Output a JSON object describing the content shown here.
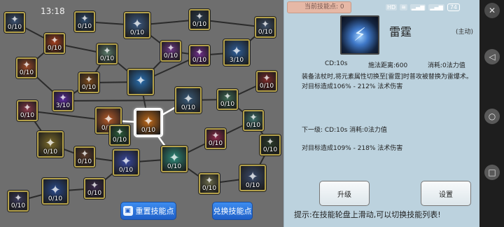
{
  "status_bar": {
    "time": "13:18",
    "signals": [
      "HD",
      "wifi",
      "HD"
    ],
    "battery": "74"
  },
  "tree": {
    "buttons": [
      {
        "label": "重置技能点"
      },
      {
        "label": "兑换技能点"
      }
    ],
    "nodes": [
      {
        "level": "0/10",
        "color": "#3a4f6e",
        "icon": "chain-icon"
      },
      {
        "level": "0/10",
        "color": "#2f4a6a",
        "icon": "wisp-icon"
      },
      {
        "level": "0/10",
        "color": "#3c5a82",
        "icon": "spiral-icon"
      },
      {
        "level": "0/10",
        "color": "#2a3a4a",
        "icon": "beetle-icon"
      },
      {
        "level": "0/10",
        "color": "#a33e1e",
        "icon": "fire-icon"
      },
      {
        "level": "0/10",
        "color": "#3d4f66",
        "icon": "shell-icon"
      },
      {
        "level": "0/10",
        "color": "#5b7a6a",
        "icon": "wave-icon"
      },
      {
        "level": "0/10",
        "color": "#6f3a86",
        "icon": "rune-icon"
      },
      {
        "level": "3/10",
        "color": "#2f5f9a",
        "icon": "thunder-icon"
      },
      {
        "level": "0/10",
        "color": "#9a4a2a",
        "icon": "eye-icon"
      },
      {
        "level": "0/10",
        "color": "#7a4a1e",
        "icon": "sword-icon"
      },
      {
        "level": "",
        "color": "#2a6fb0",
        "icon": "ice-knight-icon"
      },
      {
        "level": "0/10",
        "color": "#6f2f8a",
        "icon": "storm-icon"
      },
      {
        "level": "0/10",
        "color": "#b35a2a",
        "icon": "meteor-icon"
      },
      {
        "level": "0/10",
        "color": "#7a2a2a",
        "icon": "blood-icon"
      },
      {
        "level": "3/10",
        "color": "#5a2a9a",
        "icon": "lightning-icon"
      },
      {
        "level": "0/10",
        "color": "#3f6a55",
        "icon": "rock-icon"
      },
      {
        "level": "0/10",
        "color": "#8a3a4a",
        "icon": "orb-icon"
      },
      {
        "level": "0/10",
        "color": "#c06a1a",
        "icon": "flame-icon"
      },
      {
        "level": "0/10",
        "color": "#3a5a78",
        "icon": "missile-icon"
      },
      {
        "level": "0/10",
        "color": "#3f6f6a",
        "icon": "wind-icon"
      },
      {
        "level": "0/10",
        "color": "#7a6a2a",
        "icon": "armor-icon"
      },
      {
        "level": "0/10",
        "color": "#5a3a2a",
        "icon": "spear-icon"
      },
      {
        "level": "0/10",
        "color": "#3a4aa0",
        "icon": "arcane-icon"
      },
      {
        "level": "0/10",
        "color": "#2f8a7a",
        "icon": "blade-icon"
      },
      {
        "level": "0/10",
        "color": "#8a2a4a",
        "icon": "pillar-icon"
      },
      {
        "level": "0/10",
        "color": "#2a3a2a",
        "icon": "tornado-icon"
      },
      {
        "level": "0/10",
        "color": "#3a4a6a",
        "icon": "claw-icon"
      },
      {
        "level": "0/10",
        "color": "#6a6a4a",
        "icon": "serpent-icon"
      },
      {
        "level": "0/10",
        "color": "#3a2a4a",
        "icon": "shadow-icon"
      },
      {
        "level": "0/10",
        "color": "#2a4a8a",
        "icon": "shield-icon"
      },
      {
        "level": "0/10",
        "color": "#3a3a5a",
        "icon": "sigil-icon"
      },
      {
        "level": "0/10",
        "color": "#2a5a3a",
        "icon": "vortex-icon"
      }
    ]
  },
  "panel": {
    "points_label": "当前技能点: 0",
    "skill": {
      "name": "雷霆",
      "type": "(主动)",
      "cd": "CD:10s",
      "range": "施法距离:600",
      "cost": "消耗:0法力值",
      "description": "装备法杖时,将元素属性切换至[雷霆]时普攻被替换为雷爆术。",
      "current_damage": "对目标造成106% - 212% 法术伤害",
      "next_level": "下一级: CD:10s 消耗:0法力值",
      "next_damage": "对目标造成109% - 218% 法术伤害"
    },
    "upgrade_button": "升级",
    "settings_button": "设置",
    "tip": "提示:在技能轮盘上滑动,可以切换技能列表!"
  }
}
